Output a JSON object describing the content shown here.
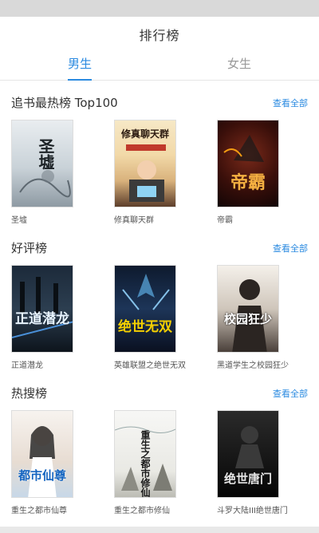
{
  "header": {
    "title": "排行榜"
  },
  "tabs": [
    {
      "label": "男生",
      "active": true
    },
    {
      "label": "女生",
      "active": false
    }
  ],
  "sections": [
    {
      "title": "追书最热榜 Top100",
      "more": "查看全部",
      "books": [
        {
          "name": "圣墟",
          "cover_text": "圣墟"
        },
        {
          "name": "修真聊天群",
          "cover_text": "修真聊天群"
        },
        {
          "name": "帝霸",
          "cover_text": "帝霸"
        }
      ]
    },
    {
      "title": "好评榜",
      "more": "查看全部",
      "books": [
        {
          "name": "正道潜龙",
          "cover_text": "正道潜龙"
        },
        {
          "name": "英雄联盟之绝世无双",
          "cover_text": "绝世无双"
        },
        {
          "name": "黑道学生之校园狂少",
          "cover_text": "校园狂少"
        }
      ]
    },
    {
      "title": "热搜榜",
      "more": "查看全部",
      "books": [
        {
          "name": "重生之都市仙尊",
          "cover_text": "都市仙尊"
        },
        {
          "name": "重生之都市修仙",
          "cover_text": "重生之都市修仙"
        },
        {
          "name": "斗罗大陆III绝世唐门",
          "cover_text": "绝世唐门"
        }
      ]
    }
  ],
  "colors": {
    "accent": "#2a8ae0",
    "text": "#333333",
    "muted": "#999999"
  }
}
